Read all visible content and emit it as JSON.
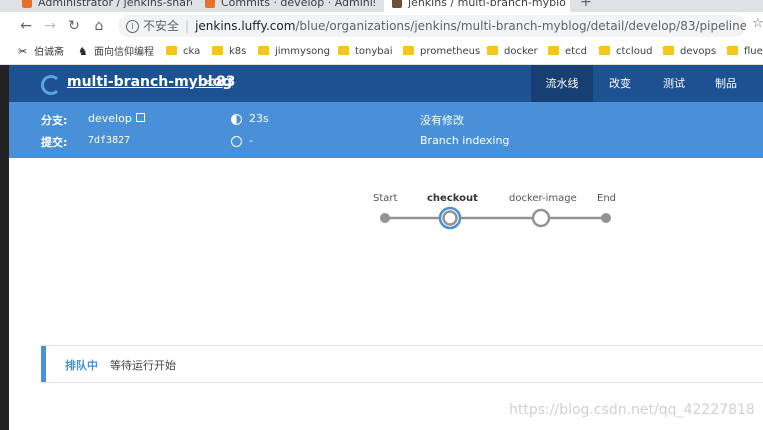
{
  "browser": {
    "tabs": [
      {
        "title": "Administrator / jenkins-shared"
      },
      {
        "title": "Commits · develop · Administr"
      },
      {
        "title": "jenkins / multi-branch-myblo"
      }
    ],
    "address": {
      "security_label": "不安全",
      "host": "jenkins.luffy.com",
      "path": "/blue/organizations/jenkins/multi-branch-myblog/detail/develop/83/pipeline"
    },
    "bookmarks": [
      {
        "label": "伯诚斋",
        "icon": "bookmark-glyph"
      },
      {
        "label": "面向信仰编程",
        "icon": "bookmark-glyph"
      },
      {
        "label": "cka",
        "icon": "folder"
      },
      {
        "label": "k8s",
        "icon": "folder"
      },
      {
        "label": "jimmysong",
        "icon": "folder"
      },
      {
        "label": "tonybai",
        "icon": "folder"
      },
      {
        "label": "prometheus",
        "icon": "folder"
      },
      {
        "label": "docker",
        "icon": "folder"
      },
      {
        "label": "etcd",
        "icon": "folder"
      },
      {
        "label": "ctcloud",
        "icon": "folder"
      },
      {
        "label": "devops",
        "icon": "folder"
      },
      {
        "label": "fluer",
        "icon": "folder"
      }
    ]
  },
  "header": {
    "pipeline_name": "multi-branch-myblog",
    "run_separator": "<",
    "run_number": "83",
    "tabs": [
      {
        "label": "流水线",
        "active": true
      },
      {
        "label": "改变",
        "active": false
      },
      {
        "label": "测试",
        "active": false
      },
      {
        "label": "制品",
        "active": false
      }
    ]
  },
  "run_info": {
    "branch_label": "分支:",
    "branch_value": "develop",
    "commit_label": "提交:",
    "commit_value": "7df3827",
    "duration": "23s",
    "finished": "-",
    "changes": "没有修改",
    "cause": "Branch indexing"
  },
  "pipeline_graph": {
    "stages": [
      {
        "name": "Start",
        "state": "start"
      },
      {
        "name": "checkout",
        "state": "running"
      },
      {
        "name": "docker-image",
        "state": "queued"
      },
      {
        "name": "End",
        "state": "end"
      }
    ],
    "colors": {
      "line": "#949393",
      "running": "#4a90d9",
      "node": "#949393"
    }
  },
  "status_panel": {
    "title": "排队中",
    "message": "等待运行开始"
  },
  "watermark": "https://blog.csdn.net/qq_42227818"
}
